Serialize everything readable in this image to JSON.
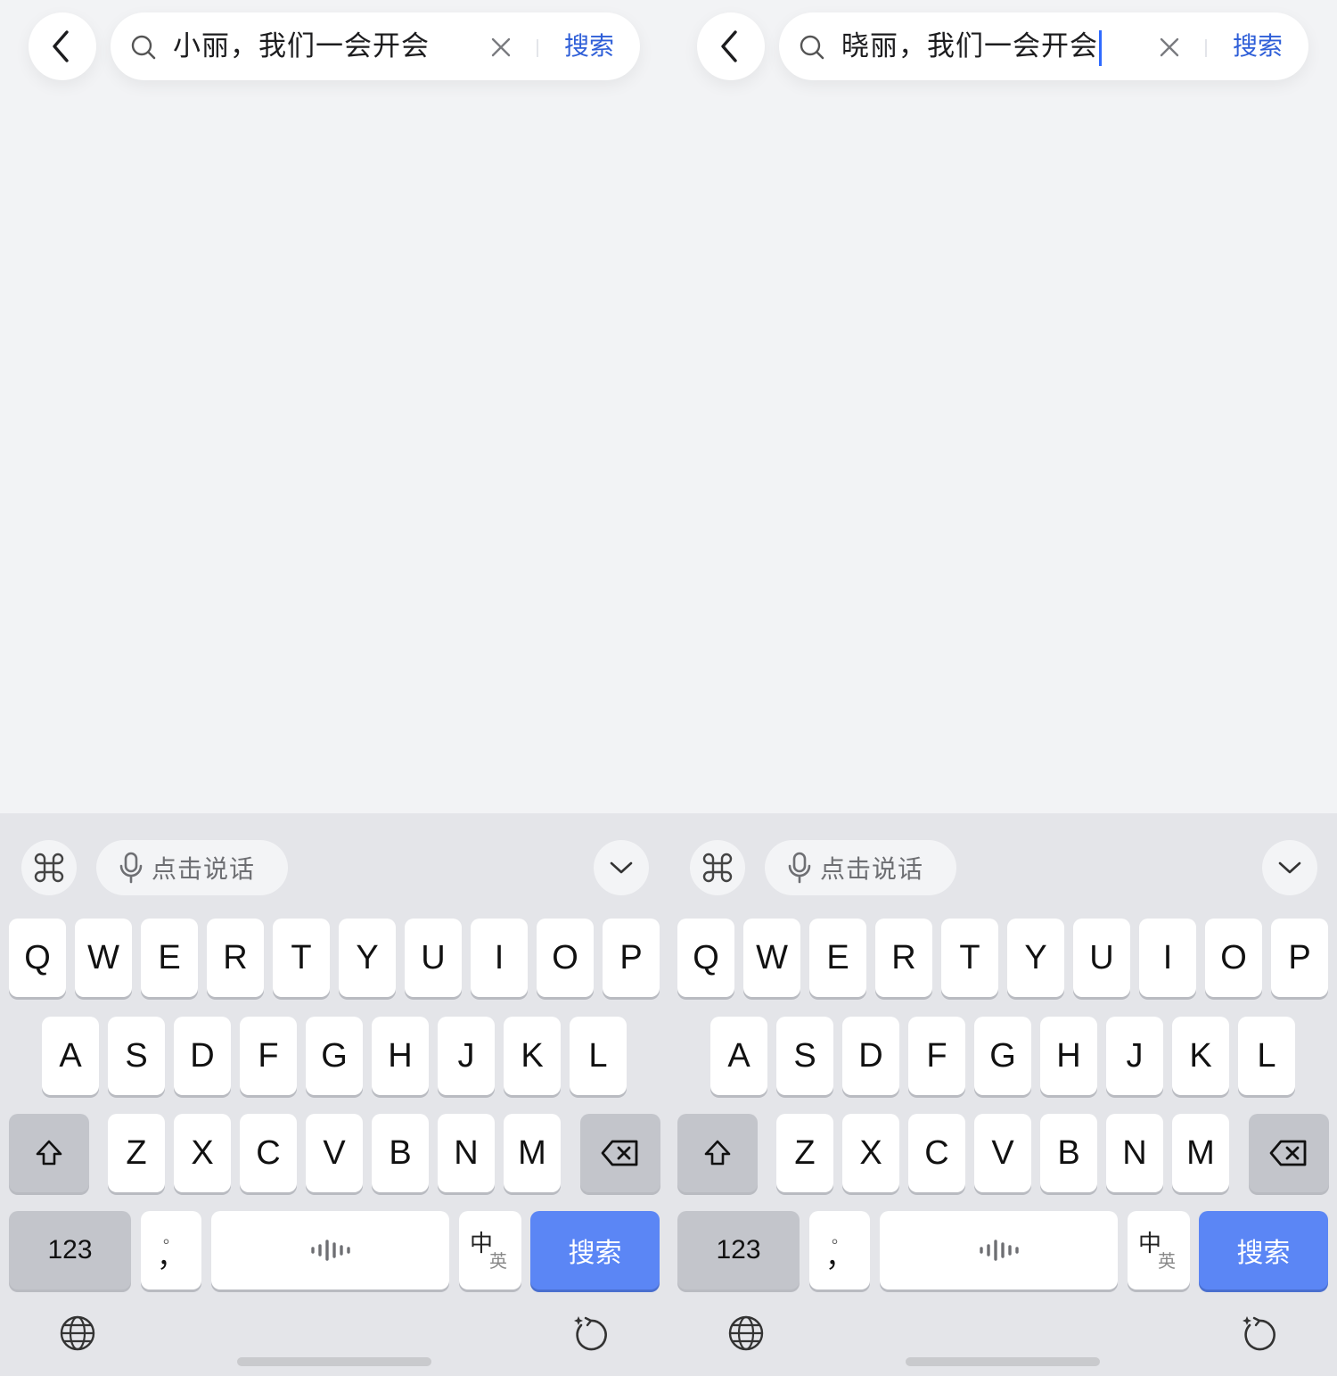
{
  "panels": [
    {
      "query_text": "小丽，我们一会开会",
      "show_caret": false,
      "search_button": "搜索",
      "keyboard": {
        "voice_label": "点击说话",
        "row1": [
          "Q",
          "W",
          "E",
          "R",
          "T",
          "Y",
          "U",
          "I",
          "O",
          "P"
        ],
        "row2": [
          "A",
          "S",
          "D",
          "F",
          "G",
          "H",
          "J",
          "K",
          "L"
        ],
        "row3": [
          "Z",
          "X",
          "C",
          "V",
          "B",
          "N",
          "M"
        ],
        "numbers_key": "123",
        "punct_top": "。",
        "punct_bottom": "，",
        "lang_key_primary": "中",
        "lang_key_secondary": "英",
        "enter_key": "搜索"
      }
    },
    {
      "query_text": "晓丽，我们一会开会",
      "show_caret": true,
      "search_button": "搜索",
      "keyboard": {
        "voice_label": "点击说话",
        "row1": [
          "Q",
          "W",
          "E",
          "R",
          "T",
          "Y",
          "U",
          "I",
          "O",
          "P"
        ],
        "row2": [
          "A",
          "S",
          "D",
          "F",
          "G",
          "H",
          "J",
          "K",
          "L"
        ],
        "row3": [
          "Z",
          "X",
          "C",
          "V",
          "B",
          "N",
          "M"
        ],
        "numbers_key": "123",
        "punct_top": "。",
        "punct_bottom": "，",
        "lang_key_primary": "中",
        "lang_key_secondary": "英",
        "enter_key": "搜索"
      }
    }
  ],
  "colors": {
    "background": "#f2f3f5",
    "keyboard_bg": "#e4e5e9",
    "accent": "#5b86f5",
    "search_link": "#2f5fd8",
    "caret": "#2f6bff"
  },
  "icons": [
    "back-chevron-icon",
    "search-icon",
    "clear-icon",
    "command-icon",
    "microphone-icon",
    "chevron-down-icon",
    "shift-icon",
    "backspace-icon",
    "voice-wave-icon",
    "globe-icon",
    "reset-icon"
  ]
}
